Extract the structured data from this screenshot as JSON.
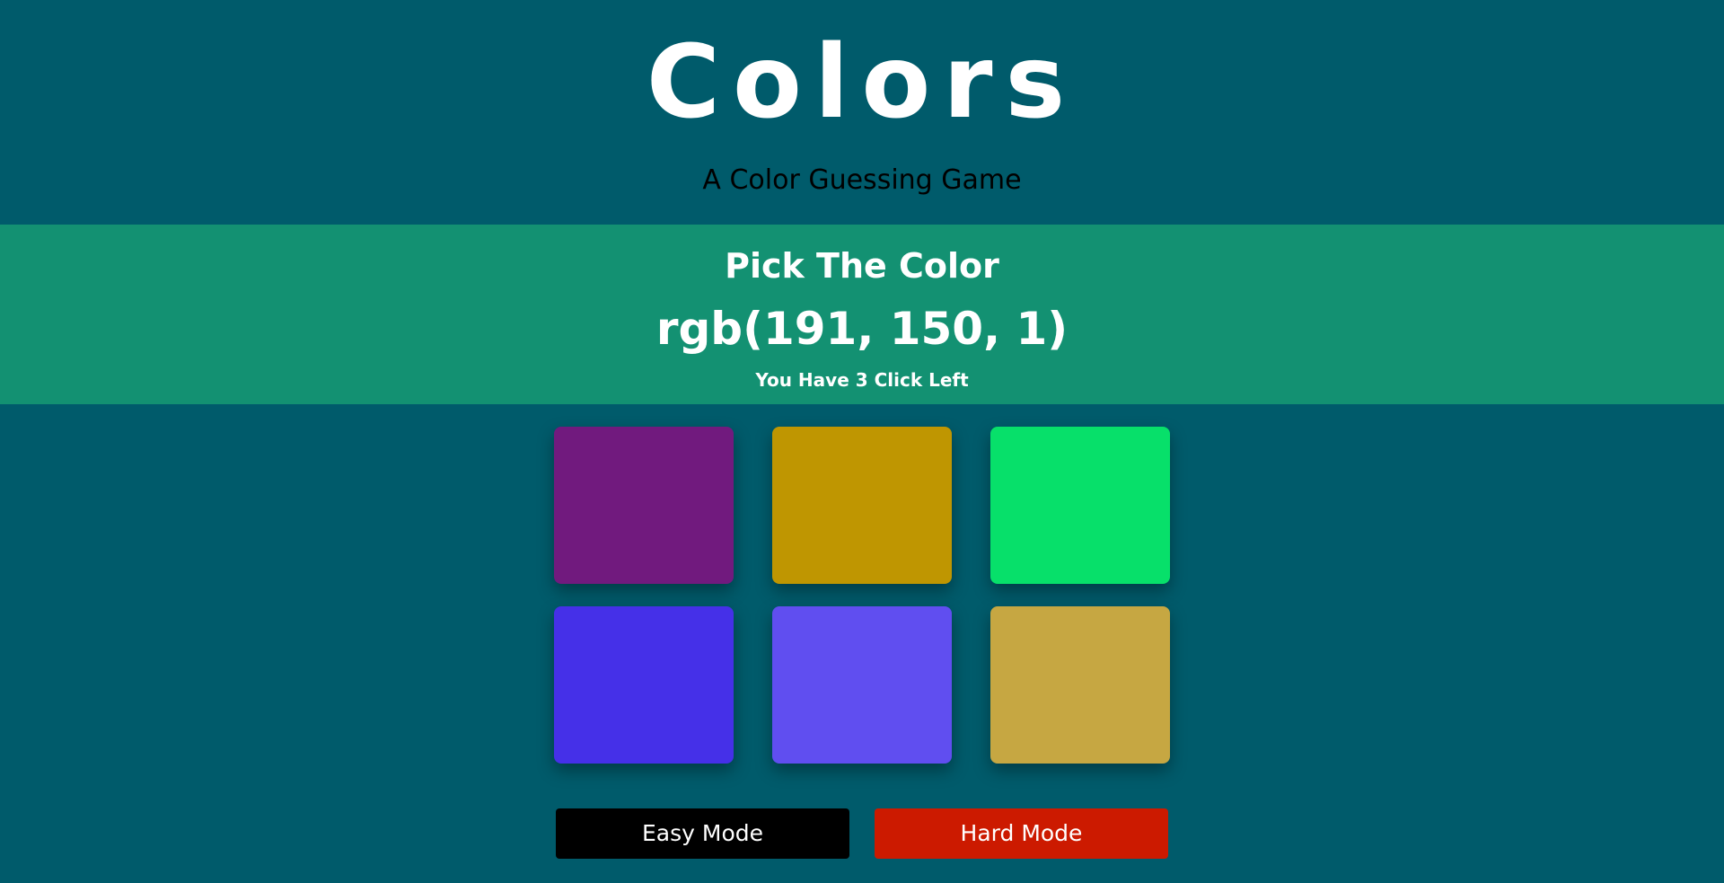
{
  "header": {
    "title": "Colors",
    "subtitle": "A Color Guessing Game"
  },
  "banner": {
    "prompt": "Pick The Color",
    "target_color": "rgb(191, 150, 1)",
    "clicks_left": "You Have 3 Click Left"
  },
  "squares": [
    {
      "color": "#711a7e"
    },
    {
      "color": "#bf9601"
    },
    {
      "color": "#07e06a"
    },
    {
      "color": "#4530e8"
    },
    {
      "color": "#604ef0"
    },
    {
      "color": "#c6a742"
    }
  ],
  "buttons": {
    "easy_label": "Easy Mode",
    "hard_label": "Hard Mode"
  },
  "colors": {
    "background": "#005b6b",
    "banner": "#139172",
    "easy_button": "#000000",
    "hard_button": "#cc1a00"
  }
}
